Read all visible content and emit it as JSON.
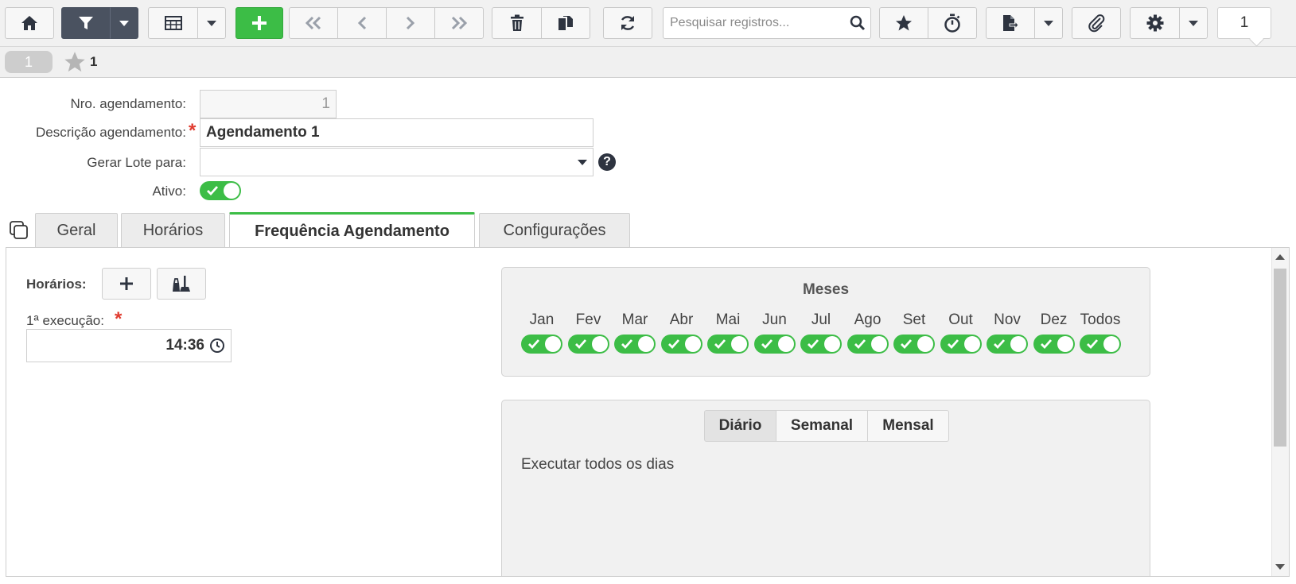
{
  "toolbar": {
    "search_placeholder": "Pesquisar registros...",
    "record_counter": "1"
  },
  "record_bar": {
    "record_number": "1",
    "favorites_count": "1"
  },
  "form": {
    "nro_label": "Nro. agendamento:",
    "nro_value": "1",
    "descricao_label": "Descrição agendamento:",
    "descricao_value": "Agendamento 1",
    "gerar_lote_label": "Gerar Lote para:",
    "gerar_lote_value": "",
    "ativo_label": "Ativo:",
    "ativo_value": true
  },
  "tabs": [
    {
      "label": "Geral",
      "active": false
    },
    {
      "label": "Horários",
      "active": false
    },
    {
      "label": "Frequência Agendamento",
      "active": true
    },
    {
      "label": "Configurações",
      "active": false
    }
  ],
  "panel": {
    "horarios_label": "Horários:",
    "primeira_execucao_label": "1ª execução:",
    "primeira_execucao_value": "14:36",
    "meses": {
      "title": "Meses",
      "months": [
        "Jan",
        "Fev",
        "Mar",
        "Abr",
        "Mai",
        "Jun",
        "Jul",
        "Ago",
        "Set",
        "Out",
        "Nov",
        "Dez",
        "Todos"
      ],
      "all_enabled": true
    },
    "frequencia": {
      "options": [
        "Diário",
        "Semanal",
        "Mensal"
      ],
      "selected": "Diário",
      "description": "Executar todos os dias"
    }
  },
  "colors": {
    "accent_green": "#3cbd46",
    "dark_button": "#4a5260",
    "required_red": "#e03b2f"
  }
}
